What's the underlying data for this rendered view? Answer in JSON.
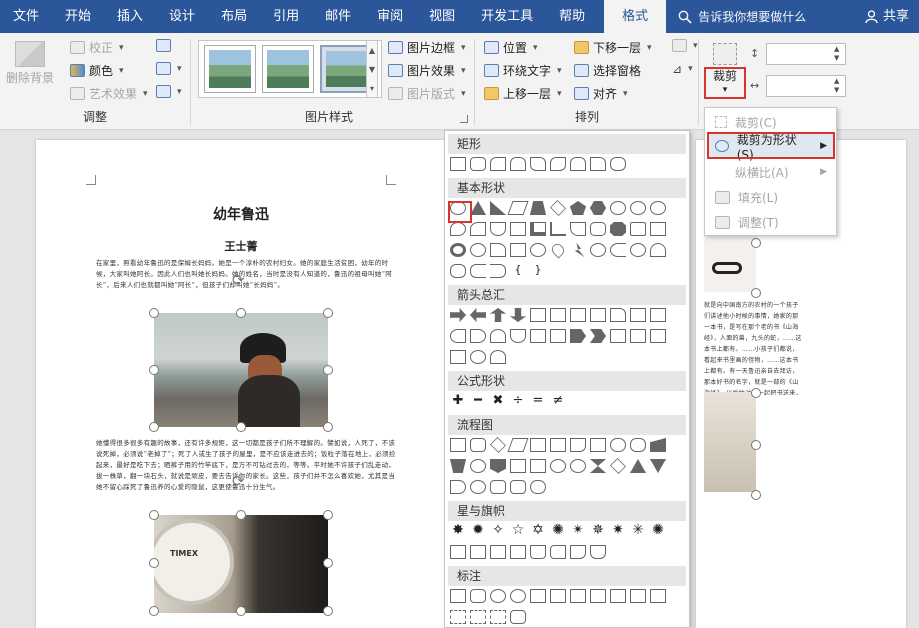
{
  "tabs": [
    "文件",
    "开始",
    "插入",
    "设计",
    "布局",
    "引用",
    "邮件",
    "审阅",
    "视图",
    "开发工具",
    "帮助",
    "格式"
  ],
  "tell_me": "告诉我你想要做什么",
  "share": "共享",
  "ribbon": {
    "remove_bg": "删除背景",
    "correct": "校正",
    "color": "颜色",
    "art_effect": "艺术效果",
    "adjust_group": "调整",
    "pic_border": "图片边框",
    "pic_effect": "图片效果",
    "pic_layout": "图片版式",
    "styles_group": "图片样式",
    "position": "位置",
    "wrap_text": "环绕文字",
    "bring_forward": "上移一层",
    "send_backward": "下移一层",
    "selection_pane": "选择窗格",
    "align": "对齐",
    "arrange_group": "排列",
    "crop": "裁剪"
  },
  "doc": {
    "title": "幼年鲁迅",
    "author": "王士菁",
    "para1": "在家里，照看幼年鲁迅的是保姆长妈妈。她是一个淳朴的农村妇女。她的家庭生活贫困，幼年的时候，大家叫她阿长。因此人们也叫她长妈妈。她的姓名，当时是没有人知道的，鲁迅的祖母叫她“阿长”，后来人们也就都叫她“阿长”，但孩子们却叫她“长妈妈”。",
    "para2": "她懂得很多很多有趣的故事，还有许多规矩，这一切都是孩子们所不理解的。譬如说，人死了，不该说死掉，必须说“老掉了”；死了人或生了孩子的屋里，是不应该走进去的；饭粒子落在地上，必须捡起来，最好是吃下去；晒裤子用的竹竿底下，是万不可钻过去的，等等。平时她不许孩子们乱走动，拔一株草，翻一块石头，就说是顽皮，要去告诉你的家长。这些，孩子们并不怎么喜欢她，尤其是当她不留心踩死了鲁迅养的心爱的隐鼠，这更使鲁迅十分生气。",
    "right_text": "就是向中国南方的农村的一个孩子们讲述他小时候的事情，她家的那一本书，是写在那个老的书《山海经》，人面的兽，九头的蛇，……这本书上都有。……小孩子们都说，看起来书里画的怪物，……这本书上都有。有一天鲁迅亲自去拜访，那本好书的名字，就是一部的《山海经》。以后她对他一起把书送来，都是要把这些给他知道，那时人们都把它当成了什么样的人，来问是怎么一回事，鲁"
  },
  "shape_menu": {
    "categories": [
      "矩形",
      "基本形状",
      "箭头总汇",
      "公式形状",
      "流程图",
      "星与旗帜",
      "标注"
    ]
  },
  "crop_menu": {
    "items": [
      "裁剪(C)",
      "裁剪为形状(S)",
      "纵横比(A)",
      "填充(L)",
      "调整(T)"
    ]
  },
  "colors": {
    "title_bar": "#2b579a",
    "highlight": "#d9342b",
    "selected_menu": "#dfe7f1"
  }
}
